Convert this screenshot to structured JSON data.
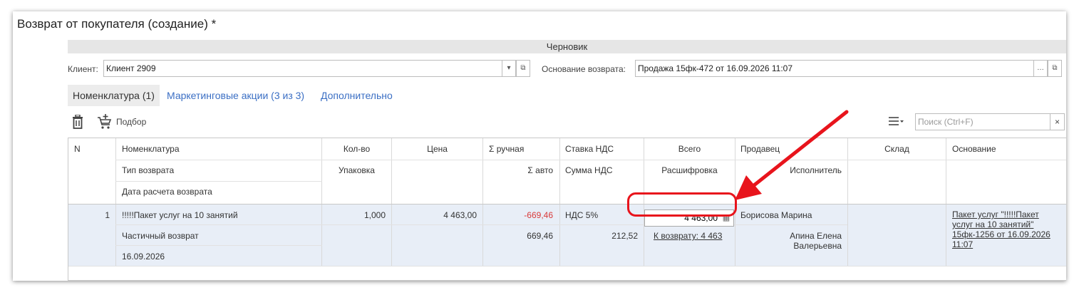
{
  "window": {
    "title": "Возврат от покупателя (создание) *",
    "status": "Черновик"
  },
  "header": {
    "client_label": "Клиент:",
    "client_value": "Клиент 2909",
    "basis_label": "Основание возврата:",
    "basis_value": "Продажа 15фк-472 от 16.09.2026 11:07"
  },
  "tabs": [
    {
      "label": "Номенклатура (1)",
      "active": true
    },
    {
      "label": "Маркетинговые акции (3 из 3)",
      "active": false
    },
    {
      "label": "Дополнительно",
      "active": false
    }
  ],
  "toolbar": {
    "pick_label": "Подбор",
    "search_placeholder": "Поиск (Ctrl+F)",
    "search_clear": "×"
  },
  "table": {
    "headers": {
      "n": "N",
      "nomenclature": "Номенклатура",
      "return_type": "Тип возврата",
      "calc_date": "Дата расчета возврата",
      "qty": "Кол-во",
      "packaging": "Упаковка",
      "price": "Цена",
      "sum_manual": "Σ ручная",
      "sum_auto": "Σ авто",
      "vat_rate": "Ставка НДС",
      "vat_sum": "Сумма НДС",
      "total": "Всего",
      "breakdown": "Расшифровка",
      "seller": "Продавец",
      "executor": "Исполнитель",
      "warehouse": "Склад",
      "basis": "Основание"
    },
    "rows": [
      {
        "n": "1",
        "nomenclature": "!!!!!Пакет услуг на 10 занятий",
        "return_type": "Частичный возврат",
        "calc_date": "16.09.2026",
        "qty": "1,000",
        "price": "4 463,00",
        "sum_manual": "-669,46",
        "sum_auto": "669,46",
        "vat_rate": "НДС 5%",
        "vat_sum": "212,52",
        "total": "4 463,00",
        "breakdown": "К возврату: 4 463",
        "seller": "Борисова Марина",
        "executor_line1": "Апина Елена",
        "executor_line2": "Валерьевна",
        "basis_lines": [
          "Пакет услуг \"!!!!!Пакет",
          "услуг на 10 занятий\"",
          "15фк-1256 от 16.09.2026",
          "11:07"
        ]
      }
    ]
  },
  "colors": {
    "accent_link": "#3b6fc4",
    "negative": "#d93a3a",
    "annotation": "#e8141c",
    "row_selected": "#e8eef7"
  }
}
